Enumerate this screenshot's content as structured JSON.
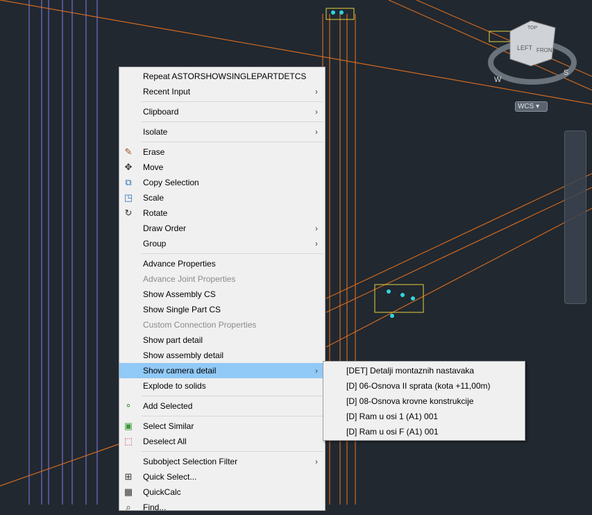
{
  "viewport": {
    "background": "#212830",
    "wcs_label": "WCS",
    "viewcube": {
      "top": "TOP",
      "left": "LEFT",
      "front": "FRONT",
      "compass": [
        "W",
        "S"
      ]
    }
  },
  "context_menu": {
    "groups": [
      [
        {
          "label": "Repeat ASTORSHOWSINGLEPARTDETCS"
        },
        {
          "label": "Recent Input",
          "submenu": true
        }
      ],
      [
        {
          "label": "Clipboard",
          "submenu": true
        }
      ],
      [
        {
          "label": "Isolate",
          "submenu": true
        }
      ],
      [
        {
          "label": "Erase",
          "icon": "eraser-icon"
        },
        {
          "label": "Move",
          "icon": "move-icon"
        },
        {
          "label": "Copy Selection",
          "icon": "copy-icon"
        },
        {
          "label": "Scale",
          "icon": "scale-icon"
        },
        {
          "label": "Rotate",
          "icon": "rotate-icon"
        },
        {
          "label": "Draw Order",
          "submenu": true
        },
        {
          "label": "Group",
          "submenu": true
        }
      ],
      [
        {
          "label": "Advance Properties"
        },
        {
          "label": "Advance Joint Properties",
          "disabled": true
        },
        {
          "label": "Show Assembly CS"
        },
        {
          "label": "Show Single Part CS"
        },
        {
          "label": "Custom Connection Properties",
          "disabled": true
        },
        {
          "label": "Show part detail"
        },
        {
          "label": "Show assembly detail"
        },
        {
          "label": "Show camera detail",
          "submenu": true,
          "highlighted": true
        },
        {
          "label": "Explode to solids"
        }
      ],
      [
        {
          "label": "Add Selected",
          "icon": "add-selected-icon"
        }
      ],
      [
        {
          "label": "Select Similar",
          "icon": "select-similar-icon"
        },
        {
          "label": "Deselect All",
          "icon": "deselect-all-icon"
        }
      ],
      [
        {
          "label": "Subobject Selection Filter",
          "submenu": true
        },
        {
          "label": "Quick Select...",
          "icon": "quick-select-icon"
        },
        {
          "label": "QuickCalc",
          "icon": "calculator-icon"
        },
        {
          "label": "Find...",
          "icon": "find-icon"
        }
      ]
    ]
  },
  "camera_submenu": {
    "items": [
      "[DET] Detalji montaznih nastavaka",
      "[D] 06-Osnova II sprata (kota +11,00m)",
      "[D] 08-Osnova krovne konstrukcije",
      "[D] Ram u osi 1 (A1) 001",
      "[D] Ram u osi F (A1) 001"
    ]
  }
}
